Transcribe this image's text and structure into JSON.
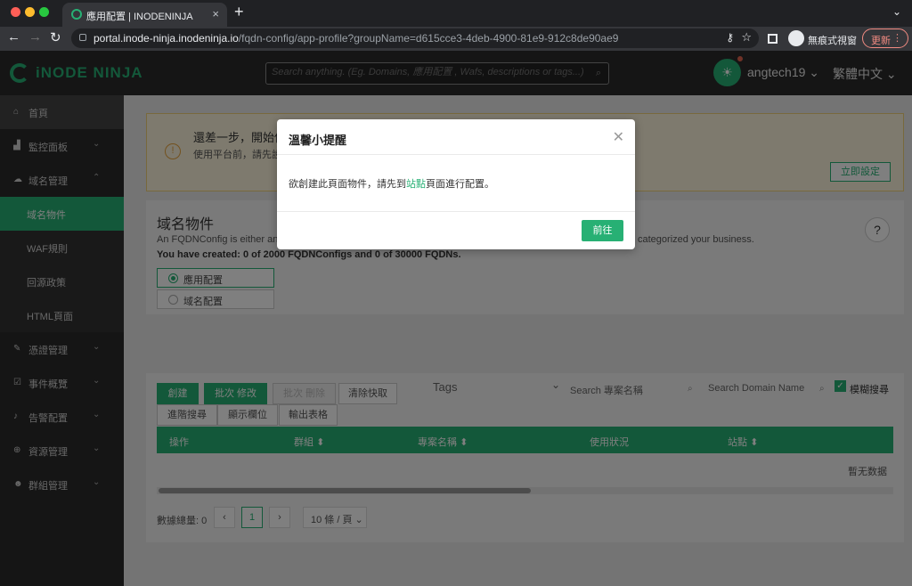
{
  "browser": {
    "tab_title": "應用配置 | INODENINJA",
    "tab_close": "×",
    "new_tab": "+",
    "url_host": "portal.inode-ninja.inodeninja.io",
    "url_path": "/fqdn-config/app-profile?groupName=d615cce3-4deb-4900-81e9-912c8de90ae9",
    "incognito_label": "無痕式視窗",
    "update_label": "更新"
  },
  "header": {
    "logo_text": "iNODE NINJA",
    "search_placeholder": "Search anything. (Eg. Domains, 應用配置 , Wafs, descriptions or tags...)",
    "username": "angtech19",
    "language": "繁體中文"
  },
  "sidebar": {
    "items": [
      {
        "label": "首頁",
        "icon": "home-icon",
        "glyph": "⌂"
      },
      {
        "label": "監控面板",
        "icon": "chart-icon",
        "glyph": "▟"
      },
      {
        "label": "域名管理",
        "icon": "cloud-icon",
        "glyph": "☁"
      },
      {
        "label": "域名物件"
      },
      {
        "label": "WAF規則"
      },
      {
        "label": "回源政策"
      },
      {
        "label": "HTML頁面"
      },
      {
        "label": "憑證管理",
        "icon": "pen-icon",
        "glyph": "✎"
      },
      {
        "label": "事件概覽",
        "icon": "check-square-icon",
        "glyph": "☑"
      },
      {
        "label": "告警配置",
        "icon": "bell-icon",
        "glyph": "♪"
      },
      {
        "label": "資源管理",
        "icon": "globe-icon",
        "glyph": "⊕"
      },
      {
        "label": "群組管理",
        "icon": "users-icon",
        "glyph": "☻"
      }
    ]
  },
  "notice": {
    "title": "還差一步，開始使",
    "body": "使用平台前，請先設",
    "button": "立即設定"
  },
  "section": {
    "title": "域名物件",
    "desc_left": "An FQDNConfig is either an",
    "desc_right": "categorized your business.",
    "created": "You have created: 0 of 2000 FQDNConfigs and 0 of 30000 FQDNs.",
    "radio_app": "應用配置",
    "radio_domain": "域名配置",
    "help": "?"
  },
  "toolbar": {
    "create": "創建",
    "batch_edit": "批次 修改",
    "batch_delete": "批次 刪除",
    "clear_cache": "清除快取",
    "advanced_search": "進階搜尋",
    "show_columns": "顯示欄位",
    "export": "輸出表格",
    "tags": "Tags",
    "search_project": "Search  專案名稱",
    "search_domain": "Search Domain Name",
    "fuzzy": "模糊搜尋"
  },
  "table": {
    "headers": [
      "操作",
      "群組",
      "專案名稱",
      "使用狀況",
      "站點"
    ],
    "sort_marks": [
      "",
      "⬍",
      "⬍",
      "",
      "⬍"
    ],
    "empty": "暫无数据"
  },
  "pagination": {
    "total": "數據總量: 0",
    "current": "1",
    "page_size": "10 條 / 頁"
  },
  "modal": {
    "title": "溫馨小提醒",
    "body_before": "欲創建此頁面物件，請先到",
    "body_link": "站點",
    "body_after": "頁面進行配置。",
    "confirm": "前往"
  }
}
